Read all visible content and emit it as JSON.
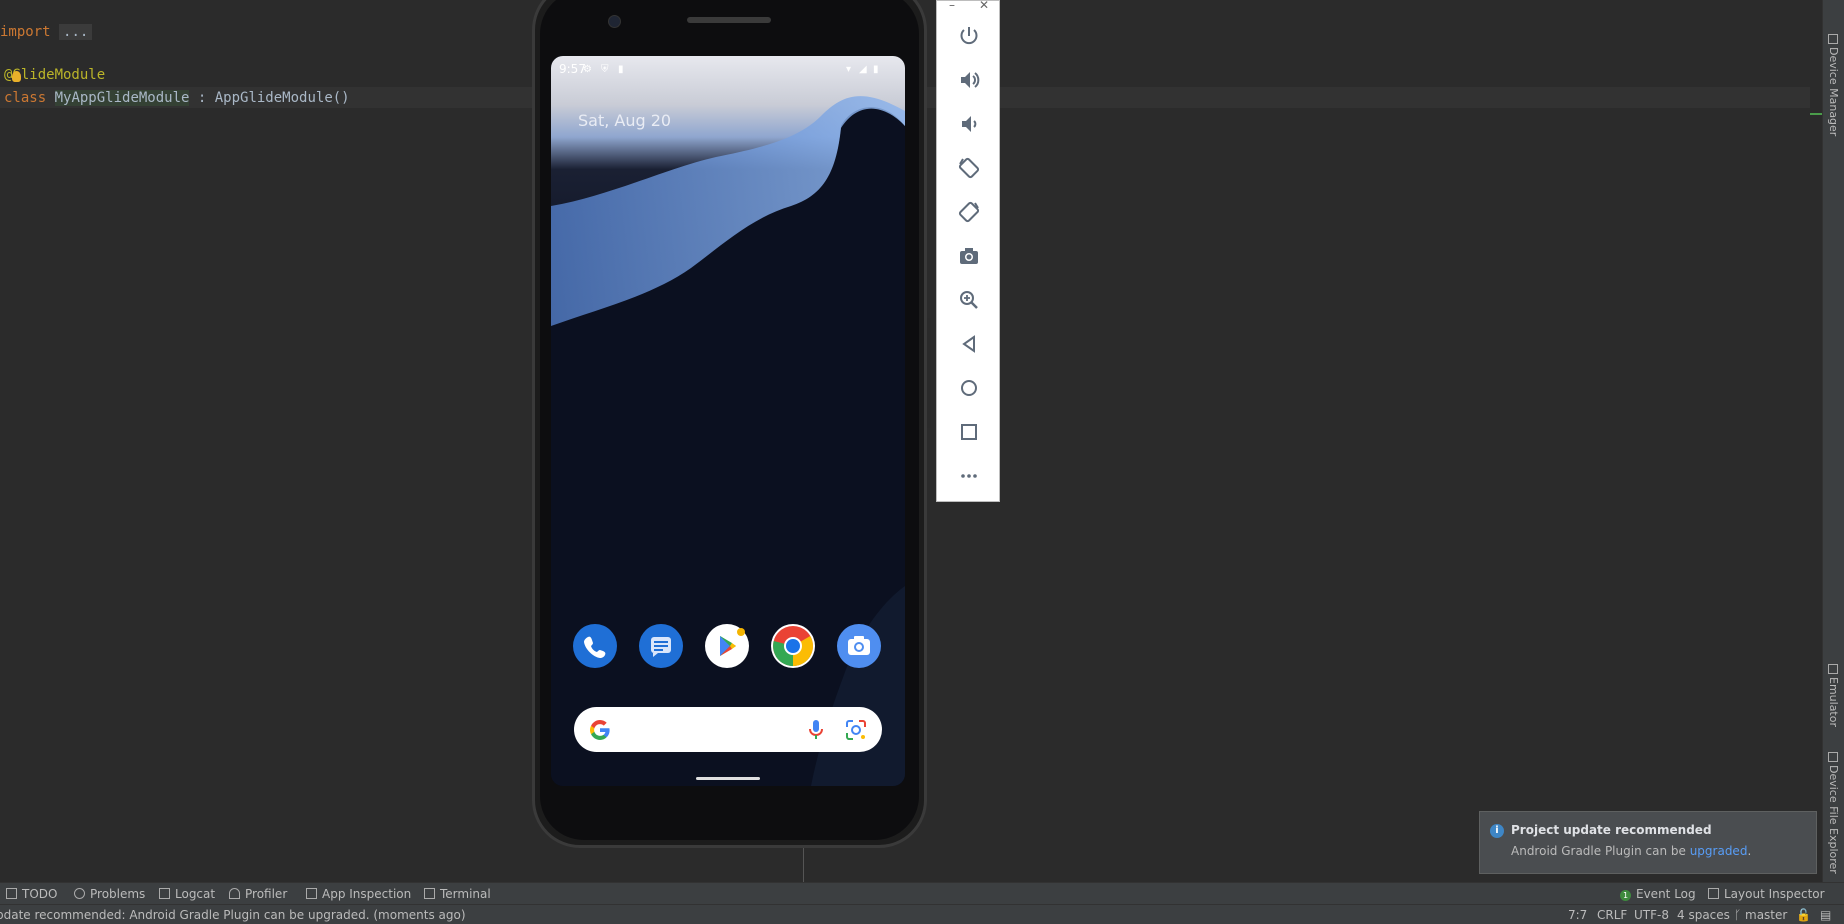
{
  "editor": {
    "line1": {
      "keyword": "import",
      "fold": "..."
    },
    "line2": {
      "annotation": "@GlideModule"
    },
    "line3": {
      "keyword": "class",
      "class_name": "MyAppGlideModule",
      "rest": " : AppGlideModule()"
    }
  },
  "right_strip": {
    "tabs": [
      "Device Manager",
      "Emulator",
      "Device File Explorer"
    ]
  },
  "phone": {
    "status": {
      "time": "9:57"
    },
    "date": "Sat, Aug 20",
    "dock_apps": [
      "phone-app-icon",
      "messages-app-icon",
      "play-store-app-icon",
      "chrome-app-icon",
      "camera-app-icon"
    ]
  },
  "emulator_toolbar": {
    "minimize": "–",
    "close": "✕",
    "buttons": [
      "power",
      "volume-up",
      "volume-down",
      "rotate-left",
      "rotate-right",
      "screenshot",
      "zoom",
      "back",
      "home",
      "overview",
      "more"
    ]
  },
  "notification": {
    "title": "Project update recommended",
    "body_prefix": "Android Gradle Plugin can be ",
    "link": "upgraded",
    "body_suffix": "."
  },
  "tool_windows": {
    "left": [
      "TODO",
      "Problems",
      "Logcat",
      "Profiler",
      "App Inspection",
      "Terminal"
    ],
    "event_log": "Event Log",
    "event_count": "1",
    "layout_inspector": "Layout Inspector"
  },
  "status_bar": {
    "message": "pdate recommended: Android Gradle Plugin can be upgraded. (moments ago)",
    "position": "7:7",
    "line_sep": "CRLF",
    "encoding": "UTF-8",
    "indent": "4 spaces",
    "branch": "master"
  },
  "colors": {
    "editor_bg": "#2b2b2b",
    "keyword": "#cc7832",
    "annotation": "#bbb529",
    "link": "#589df6"
  }
}
